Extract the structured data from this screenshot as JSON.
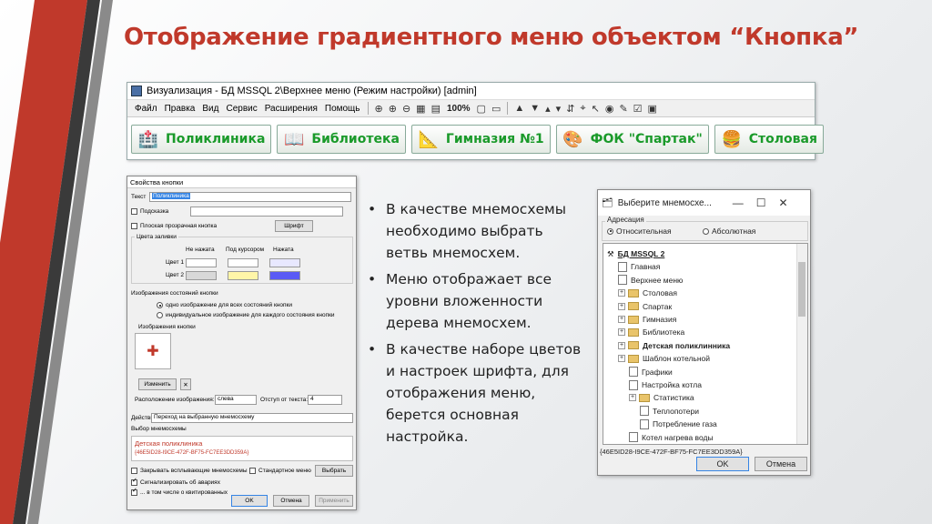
{
  "slide_title": "Отображение градиентного меню объектом “Кнопка”",
  "app": {
    "title": "Визуализация - БД MSSQL 2\\Верхнее меню (Режим настройки) [admin]",
    "menu": [
      "Файл",
      "Правка",
      "Вид",
      "Сервис",
      "Расширения",
      "Помощь"
    ],
    "zoom": "100%",
    "buttons": [
      {
        "label": "Поликлиника",
        "icon": "clinic-icon"
      },
      {
        "label": "Библиотека",
        "icon": "book-icon"
      },
      {
        "label": "Гимназия №1",
        "icon": "compass-icon"
      },
      {
        "label": "ФОК \"Спартак\"",
        "icon": "palette-icon"
      },
      {
        "label": "Столовая",
        "icon": "burger-icon"
      }
    ]
  },
  "props": {
    "title": "Свойства кнопки",
    "text_label": "Текст",
    "text_value": "Поликлиника",
    "hint_label": "Подсказка",
    "flat_label": "Плоская прозрачная кнопка",
    "font_btn": "Шрифт",
    "fill_group": "Цвета заливки",
    "col_pressed_not": "Не нажата",
    "col_hover": "Под курсором",
    "col_pressed": "Нажата",
    "color1": "Цвет 1",
    "color2": "Цвет 2",
    "states_group": "Изображения состояний кнопки",
    "radio1": "одно изображение для всех состояний кнопки",
    "radio2": "индивидуальное изображение для каждого состояния кнопки",
    "images_label": "Изображения кнопки",
    "change_btn": "Изменить",
    "x_btn": "✕",
    "layout_label": "Расположение изображения:",
    "layout_value": "слева",
    "indent_label": "Отступ от текста:",
    "indent_value": "4",
    "action_label": "Действие",
    "action_value": "Переход на выбранную мнемосхему",
    "choose_label": "Выбор мнемосхемы",
    "choose_name": "Детская поликлиника",
    "choose_guid": "{46E5ID28-I9CE-472F-BF75-FC7EE3DD359A}",
    "close_popup": "Закрывать всплывающие мнемосхемы",
    "std_menu": "Стандартное меню",
    "choose_btn": "Выбрать",
    "alarms": "Сигнализировать об авариях",
    "incl_ack": "... в том числе о квитированных",
    "ok": "OK",
    "cancel": "Отмена",
    "apply": "Применить"
  },
  "bullets": [
    "В качестве мнемосхемы необходимо выбрать ветвь мнемосхем.",
    "Меню отображает все уровни вложенности дерева мнемосхем.",
    "В качестве наборе цветов и настроек шрифта, для отображения меню, берется основная настройка."
  ],
  "select_dialog": {
    "title": "Выберите мнемосхе...",
    "addr_label": "Адресация",
    "relative": "Относительная",
    "absolute": "Абсолютная",
    "tree": [
      {
        "label": "БД MSSQL 2",
        "lvl": 0,
        "type": "root"
      },
      {
        "label": "Главная",
        "lvl": 1,
        "type": "page"
      },
      {
        "label": "Верхнее меню",
        "lvl": 1,
        "type": "page"
      },
      {
        "label": "Столовая",
        "lvl": 1,
        "type": "folder"
      },
      {
        "label": "Спартак",
        "lvl": 1,
        "type": "folder"
      },
      {
        "label": "Гимназия",
        "lvl": 1,
        "type": "folder"
      },
      {
        "label": "Библиотека",
        "lvl": 1,
        "type": "folder"
      },
      {
        "label": "Детская поликлинника",
        "lvl": 1,
        "type": "folder"
      },
      {
        "label": "Шаблон котельной",
        "lvl": 1,
        "type": "folder"
      },
      {
        "label": "Графики",
        "lvl": 2,
        "type": "page"
      },
      {
        "label": "Настройка котла",
        "lvl": 2,
        "type": "page"
      },
      {
        "label": "Статистика",
        "lvl": 2,
        "type": "folder"
      },
      {
        "label": "Теплопотери",
        "lvl": 3,
        "type": "page"
      },
      {
        "label": "Потребление газа",
        "lvl": 3,
        "type": "page"
      },
      {
        "label": "Котел нагрева воды",
        "lvl": 2,
        "type": "page"
      }
    ],
    "guid": "{46E5ID28-I9CE-472F-BF75-FC7EE3DD359A}",
    "ok": "OK",
    "cancel": "Отмена"
  }
}
